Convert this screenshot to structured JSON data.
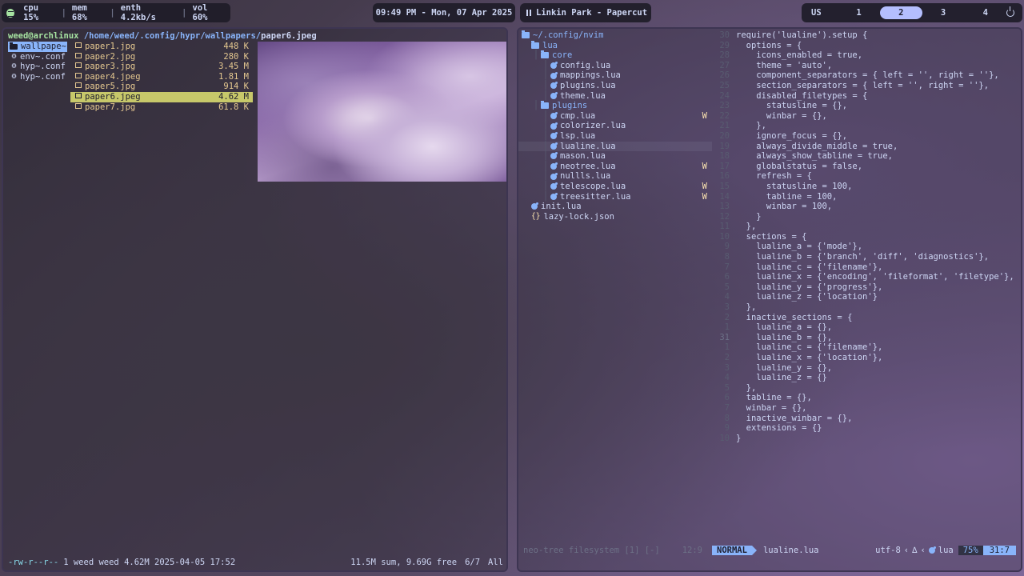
{
  "topbar": {
    "spotify_icon": "spotify-icon",
    "cpu": "cpu 15%",
    "mem": "mem 68%",
    "net": "enth 4.2kb/s",
    "vol": "vol 60%",
    "clock": "09:49 PM - Mon, 07 Apr 2025",
    "media": "Linkin Park - Papercut",
    "keyboard": "US",
    "workspaces": [
      "1",
      "2",
      "3",
      "4"
    ],
    "active_workspace": "2"
  },
  "ranger": {
    "user": "weed@archlinux",
    "path": "/home/weed/.config/hypr/wallpapers/",
    "current_file": "paper6.jpeg",
    "parent_items": [
      {
        "name": "wallpape~",
        "type": "dir"
      },
      {
        "name": "env~.conf",
        "type": "conf"
      },
      {
        "name": "hyp~.conf",
        "type": "conf"
      },
      {
        "name": "hyp~.conf",
        "type": "conf"
      }
    ],
    "files": [
      {
        "name": "paper1.jpg",
        "size": "448 K"
      },
      {
        "name": "paper2.jpg",
        "size": "280 K"
      },
      {
        "name": "paper3.jpg",
        "size": "3.45 M"
      },
      {
        "name": "paper4.jpeg",
        "size": "1.81 M"
      },
      {
        "name": "paper5.jpg",
        "size": "914 K"
      },
      {
        "name": "paper6.jpeg",
        "size": "4.62 M"
      },
      {
        "name": "paper7.jpg",
        "size": "61.8 K"
      }
    ],
    "status": {
      "perms": "-rw-r--r--",
      "info": "1 weed weed 4.62M 2025-04-05 17:52",
      "summary": "11.5M sum, 9.69G free",
      "position": "6/7",
      "scroll": "All"
    }
  },
  "neovim": {
    "tree": [
      {
        "indent": 0,
        "type": "root",
        "name": "~/.config/nvim"
      },
      {
        "indent": 1,
        "type": "dir",
        "name": "lua"
      },
      {
        "indent": 2,
        "type": "dir",
        "name": "core"
      },
      {
        "indent": 3,
        "type": "lua",
        "name": "config.lua",
        "flag": ""
      },
      {
        "indent": 3,
        "type": "lua",
        "name": "mappings.lua",
        "flag": ""
      },
      {
        "indent": 3,
        "type": "lua",
        "name": "plugins.lua",
        "flag": ""
      },
      {
        "indent": 3,
        "type": "lua",
        "name": "theme.lua",
        "flag": ""
      },
      {
        "indent": 2,
        "type": "dir",
        "name": "plugins"
      },
      {
        "indent": 3,
        "type": "lua",
        "name": "cmp.lua",
        "flag": "W"
      },
      {
        "indent": 3,
        "type": "lua",
        "name": "colorizer.lua",
        "flag": ""
      },
      {
        "indent": 3,
        "type": "lua",
        "name": "lsp.lua",
        "flag": ""
      },
      {
        "indent": 3,
        "type": "lua",
        "name": "lualine.lua",
        "flag": "",
        "current": true
      },
      {
        "indent": 3,
        "type": "lua",
        "name": "mason.lua",
        "flag": ""
      },
      {
        "indent": 3,
        "type": "lua",
        "name": "neotree.lua",
        "flag": "W"
      },
      {
        "indent": 3,
        "type": "lua",
        "name": "nullls.lua",
        "flag": ""
      },
      {
        "indent": 3,
        "type": "lua",
        "name": "telescope.lua",
        "flag": "W"
      },
      {
        "indent": 3,
        "type": "lua",
        "name": "treesitter.lua",
        "flag": "W"
      },
      {
        "indent": 1,
        "type": "lua",
        "name": "init.lua",
        "flag": ""
      },
      {
        "indent": 1,
        "type": "json",
        "name": "lazy-lock.json",
        "flag": ""
      }
    ],
    "code": [
      {
        "ln": "30",
        "text": "require('lualine').setup {"
      },
      {
        "ln": "29",
        "text": "  options = {"
      },
      {
        "ln": "28",
        "text": "    icons_enabled = true,"
      },
      {
        "ln": "27",
        "text": "    theme = 'auto',"
      },
      {
        "ln": "26",
        "text": "    component_separators = { left = '', right = ''},"
      },
      {
        "ln": "25",
        "text": "    section_separators = { left = '', right = ''},"
      },
      {
        "ln": "24",
        "text": "    disabled_filetypes = {"
      },
      {
        "ln": "23",
        "text": "      statusline = {},"
      },
      {
        "ln": "22",
        "text": "      winbar = {},"
      },
      {
        "ln": "21",
        "text": "    },"
      },
      {
        "ln": "20",
        "text": "    ignore_focus = {},"
      },
      {
        "ln": "19",
        "text": "    always_divide_middle = true,"
      },
      {
        "ln": "18",
        "text": "    always_show_tabline = true,"
      },
      {
        "ln": "17",
        "text": "    globalstatus = false,"
      },
      {
        "ln": "16",
        "text": "    refresh = {"
      },
      {
        "ln": "15",
        "text": "      statusline = 100,"
      },
      {
        "ln": "14",
        "text": "      tabline = 100,"
      },
      {
        "ln": "13",
        "text": "      winbar = 100,"
      },
      {
        "ln": "12",
        "text": "    }"
      },
      {
        "ln": "11",
        "text": "  },"
      },
      {
        "ln": "10",
        "text": "  sections = {"
      },
      {
        "ln": "9",
        "text": "    lualine_a = {'mode'},"
      },
      {
        "ln": "8",
        "text": "    lualine_b = {'branch', 'diff', 'diagnostics'},"
      },
      {
        "ln": "7",
        "text": "    lualine_c = {'filename'},"
      },
      {
        "ln": "6",
        "text": "    lualine_x = {'encoding', 'fileformat', 'filetype'},"
      },
      {
        "ln": "5",
        "text": "    lualine_y = {'progress'},"
      },
      {
        "ln": "4",
        "text": "    lualine_z = {'location'}"
      },
      {
        "ln": "3",
        "text": "  },"
      },
      {
        "ln": "2",
        "text": "  inactive_sections = {"
      },
      {
        "ln": "1",
        "text": "    lualine_a = {},"
      },
      {
        "ln": "31",
        "text": "    lualine_b = {},",
        "current": true
      },
      {
        "ln": "1",
        "text": "    lualine_c = {'filename'},"
      },
      {
        "ln": "2",
        "text": "    lualine_x = {'location'},"
      },
      {
        "ln": "3",
        "text": "    lualine_y = {},"
      },
      {
        "ln": "4",
        "text": "    lualine_z = {}"
      },
      {
        "ln": "5",
        "text": "  },"
      },
      {
        "ln": "6",
        "text": "  tabline = {},"
      },
      {
        "ln": "7",
        "text": "  winbar = {},"
      },
      {
        "ln": "8",
        "text": "  inactive_winbar = {},"
      },
      {
        "ln": "9",
        "text": "  extensions = {}"
      },
      {
        "ln": "10",
        "text": "}"
      }
    ],
    "status": {
      "tree_label": "neo-tree filesystem [1] [-]",
      "tree_pos": "12:9",
      "mode": "NORMAL",
      "filename": "lualine.lua",
      "encoding": "utf-8",
      "fileformat": "∆",
      "filetype": "lua",
      "progress": "75%",
      "location": "31:7"
    }
  },
  "colors": {
    "accent": "#89b4fa",
    "workspace_active": "#b4befe",
    "selection": "#c7c86a"
  }
}
